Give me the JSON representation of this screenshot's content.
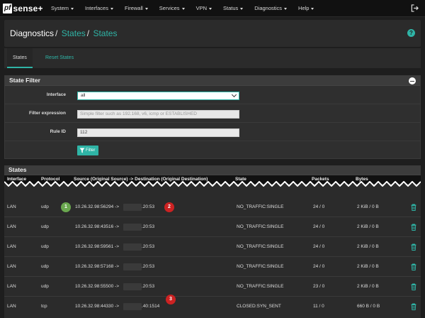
{
  "app": {
    "logo_box": "pf",
    "logo_text": "sense+"
  },
  "nav": {
    "items": [
      {
        "label": "System"
      },
      {
        "label": "Interfaces"
      },
      {
        "label": "Firewall"
      },
      {
        "label": "Services"
      },
      {
        "label": "VPN"
      },
      {
        "label": "Status"
      },
      {
        "label": "Diagnostics"
      },
      {
        "label": "Help"
      }
    ],
    "logout_icon": "logout-icon"
  },
  "breadcrumb": {
    "first": "Diagnostics",
    "second": "States",
    "third": "States",
    "separator": "/"
  },
  "help": {
    "icon": "help-icon",
    "glyph": "?"
  },
  "tabs": [
    {
      "label": "States",
      "active": true
    },
    {
      "label": "Reset States",
      "active": false
    }
  ],
  "filter": {
    "title": "State Filter",
    "interface_label": "Interface",
    "interface_value": "all",
    "expression_label": "Filter expression",
    "expression_placeholder": "Simple filter such as 192.168, v6, icmp or ESTABLISHED",
    "ruleid_label": "Rule ID",
    "ruleid_value": "112",
    "button_label": "Filter"
  },
  "states": {
    "title": "States",
    "columns": [
      "Interface",
      "Protocol",
      "Source (Original Source) -> Destination (Original Destination)",
      "State",
      "Packets",
      "Bytes"
    ],
    "rows": [
      {
        "interface": "LAN",
        "protocol": "udp",
        "source": "10.26.32.98:56294 ->",
        "dest_suffix": ".20:53",
        "state": "NO_TRAFFIC:SINGLE",
        "packets": "24 / 0",
        "bytes": "2 KiB / 0 B"
      },
      {
        "interface": "LAN",
        "protocol": "udp",
        "source": "10.26.32.98:43516 ->",
        "dest_suffix": ".20:53",
        "state": "NO_TRAFFIC:SINGLE",
        "packets": "24 / 0",
        "bytes": "2 KiB / 0 B"
      },
      {
        "interface": "LAN",
        "protocol": "udp",
        "source": "10.26.32.98:59561 ->",
        "dest_suffix": ".20:53",
        "state": "NO_TRAFFIC:SINGLE",
        "packets": "24 / 0",
        "bytes": "2 KiB / 0 B"
      },
      {
        "interface": "LAN",
        "protocol": "udp",
        "source": "10.26.32.98:57168 ->",
        "dest_suffix": ".20:53",
        "state": "NO_TRAFFIC:SINGLE",
        "packets": "24 / 0",
        "bytes": "2 KiB / 0 B"
      },
      {
        "interface": "LAN",
        "protocol": "udp",
        "source": "10.26.32.98:55500 ->",
        "dest_suffix": ".20:53",
        "state": "NO_TRAFFIC:SINGLE",
        "packets": "23 / 0",
        "bytes": "2 KiB / 0 B"
      },
      {
        "interface": "LAN",
        "protocol": "tcp",
        "source": "10.26.32.98:44330 ->",
        "dest_suffix": ".40:1514",
        "state": "CLOSED:SYN_SENT",
        "packets": "11 / 0",
        "bytes": "660 B / 0 B"
      }
    ]
  },
  "callouts": [
    {
      "label": "1",
      "color": "#6aa84f"
    },
    {
      "label": "2",
      "color": "#cc2222"
    },
    {
      "label": "3",
      "color": "#cc2222"
    }
  ],
  "colors": {
    "accent": "#2fb4a6",
    "background": "#1e1e1e",
    "panel": "#2b2b2b"
  }
}
